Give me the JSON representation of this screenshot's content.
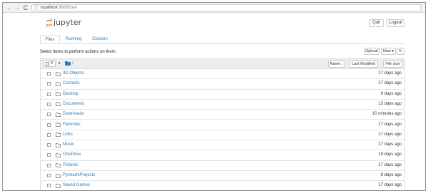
{
  "browser": {
    "url_host": "localhost",
    "url_rest": ":8888/tree",
    "back_glyph": "←",
    "forward_glyph": "→",
    "reload_glyph": "C",
    "info_glyph": "ⓘ"
  },
  "header": {
    "logo_text": "jupyter",
    "quit_label": "Quit",
    "logout_label": "Logout"
  },
  "tabs": [
    {
      "label": "Files",
      "active": true
    },
    {
      "label": "Running",
      "active": false
    },
    {
      "label": "Clusters",
      "active": false
    }
  ],
  "toolbar": {
    "instructions": "Select items to perform actions on them.",
    "upload_label": "Upload",
    "new_label": "New ▾",
    "refresh_glyph": "↻"
  },
  "list_header": {
    "selected_count": "0",
    "caret": "▾",
    "path": "/",
    "name_label": "Name ↓",
    "last_modified_label": "Last Modified",
    "file_size_label": "File size"
  },
  "rows": [
    {
      "name": "3D Objects",
      "modified": "17 days ago"
    },
    {
      "name": "Contacts",
      "modified": "17 days ago"
    },
    {
      "name": "Desktop",
      "modified": "8 days ago"
    },
    {
      "name": "Documents",
      "modified": "13 days ago"
    },
    {
      "name": "Downloads",
      "modified": "10 minutes ago"
    },
    {
      "name": "Favorites",
      "modified": "17 days ago"
    },
    {
      "name": "Links",
      "modified": "17 days ago"
    },
    {
      "name": "Music",
      "modified": "17 days ago"
    },
    {
      "name": "OneDrive",
      "modified": "19 days ago"
    },
    {
      "name": "Pictures",
      "modified": "17 days ago"
    },
    {
      "name": "PycharmProjects",
      "modified": "8 days ago"
    },
    {
      "name": "Saved Games",
      "modified": "17 days ago"
    }
  ],
  "colors": {
    "link": "#337ab7",
    "logo_orange": "#f37726"
  }
}
